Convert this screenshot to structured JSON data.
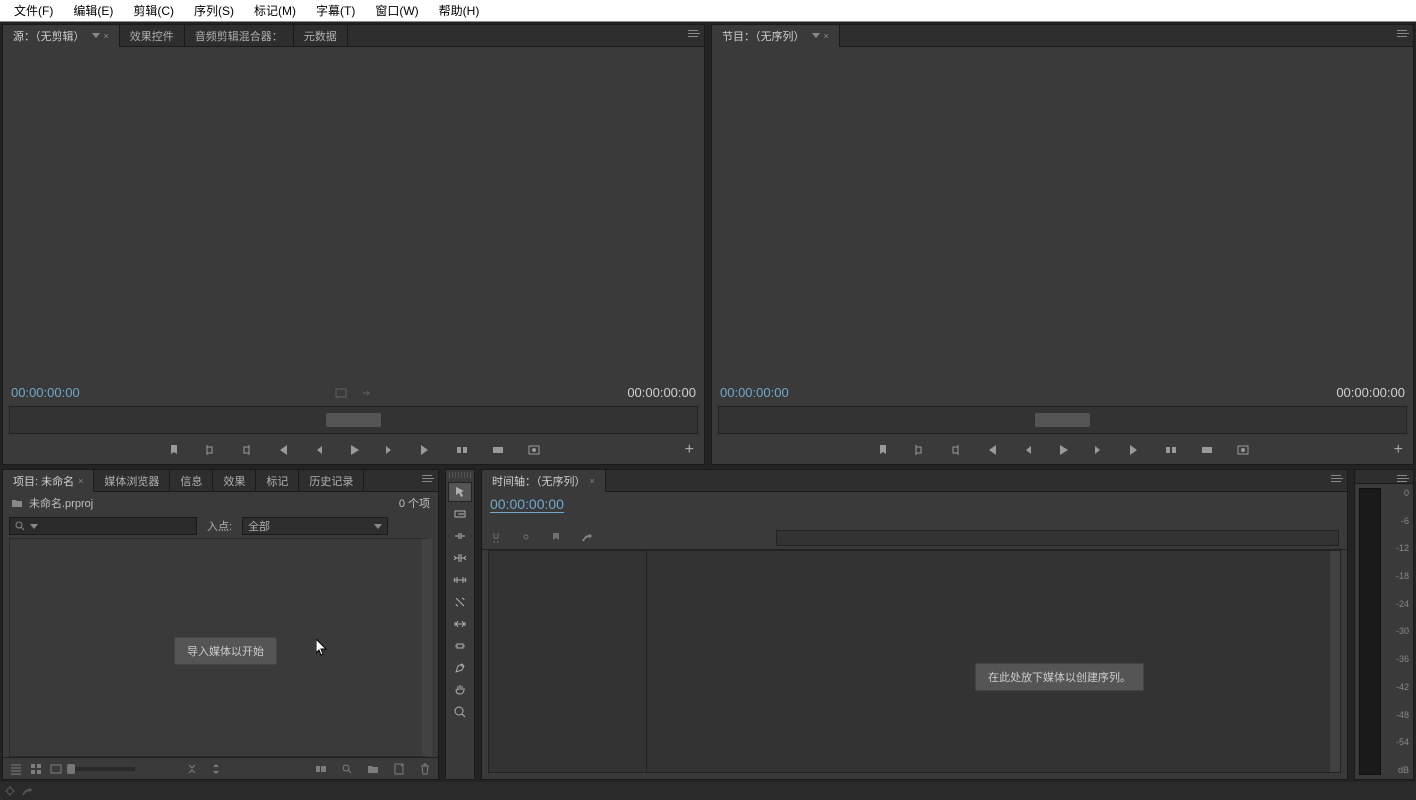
{
  "menu": [
    "文件(F)",
    "编辑(E)",
    "剪辑(C)",
    "序列(S)",
    "标记(M)",
    "字幕(T)",
    "窗口(W)",
    "帮助(H)"
  ],
  "source_panel": {
    "tabs": [
      "源：（无剪辑）",
      "效果控件",
      "音频剪辑混合器：",
      "元数据"
    ],
    "tc_left": "00:00:00:00",
    "tc_right": "00:00:00:00"
  },
  "program_panel": {
    "tab": "节目：（无序列）",
    "tc_left": "00:00:00:00",
    "tc_right": "00:00:00:00"
  },
  "project_panel": {
    "tabs": [
      "项目: 未命名",
      "媒体浏览器",
      "信息",
      "效果",
      "标记",
      "历史记录"
    ],
    "file_name": "未命名.prproj",
    "item_count": "0 个项",
    "in_label": "入点:",
    "in_value": "全部",
    "import_hint": "导入媒体以开始"
  },
  "timeline_panel": {
    "tab": "时间轴：（无序列）",
    "tc": "00:00:00:00",
    "drop_hint": "在此处放下媒体以创建序列。"
  },
  "meter_ticks": [
    "0",
    "-6",
    "-12",
    "-18",
    "-24",
    "-30",
    "-36",
    "-42",
    "-48",
    "-54",
    "dB"
  ]
}
